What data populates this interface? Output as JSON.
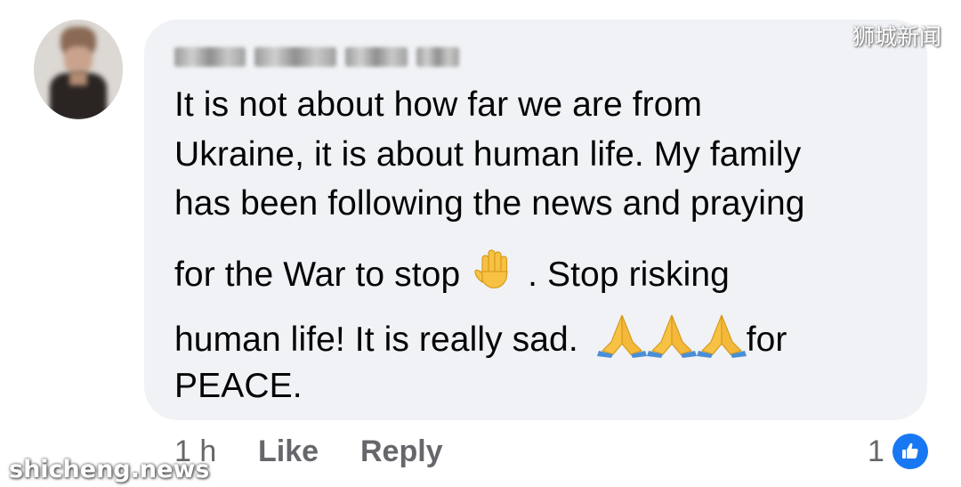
{
  "comment": {
    "lines": [
      "It is not about how far we are from",
      "Ukraine, it is about human life. My family",
      "has been following the news and praying",
      "for the War to stop",
      ".  Stop risking",
      "human life! It is really sad.",
      "for",
      "PEACE."
    ],
    "emojis": {
      "raised_hand": "raised-hand-icon",
      "praying_hands": "praying-hands-icon"
    }
  },
  "actions": {
    "time": "1 h",
    "like_label": "Like",
    "reply_label": "Reply"
  },
  "reactions": {
    "count": "1",
    "icon": "thumbs-up-icon",
    "color": "#1877f2"
  },
  "watermarks": {
    "top_right": "狮城新闻",
    "bottom_left": "shicheng.news"
  },
  "colors": {
    "bubble": "#f0f2f5",
    "text": "#050505",
    "meta": "#65676b"
  }
}
